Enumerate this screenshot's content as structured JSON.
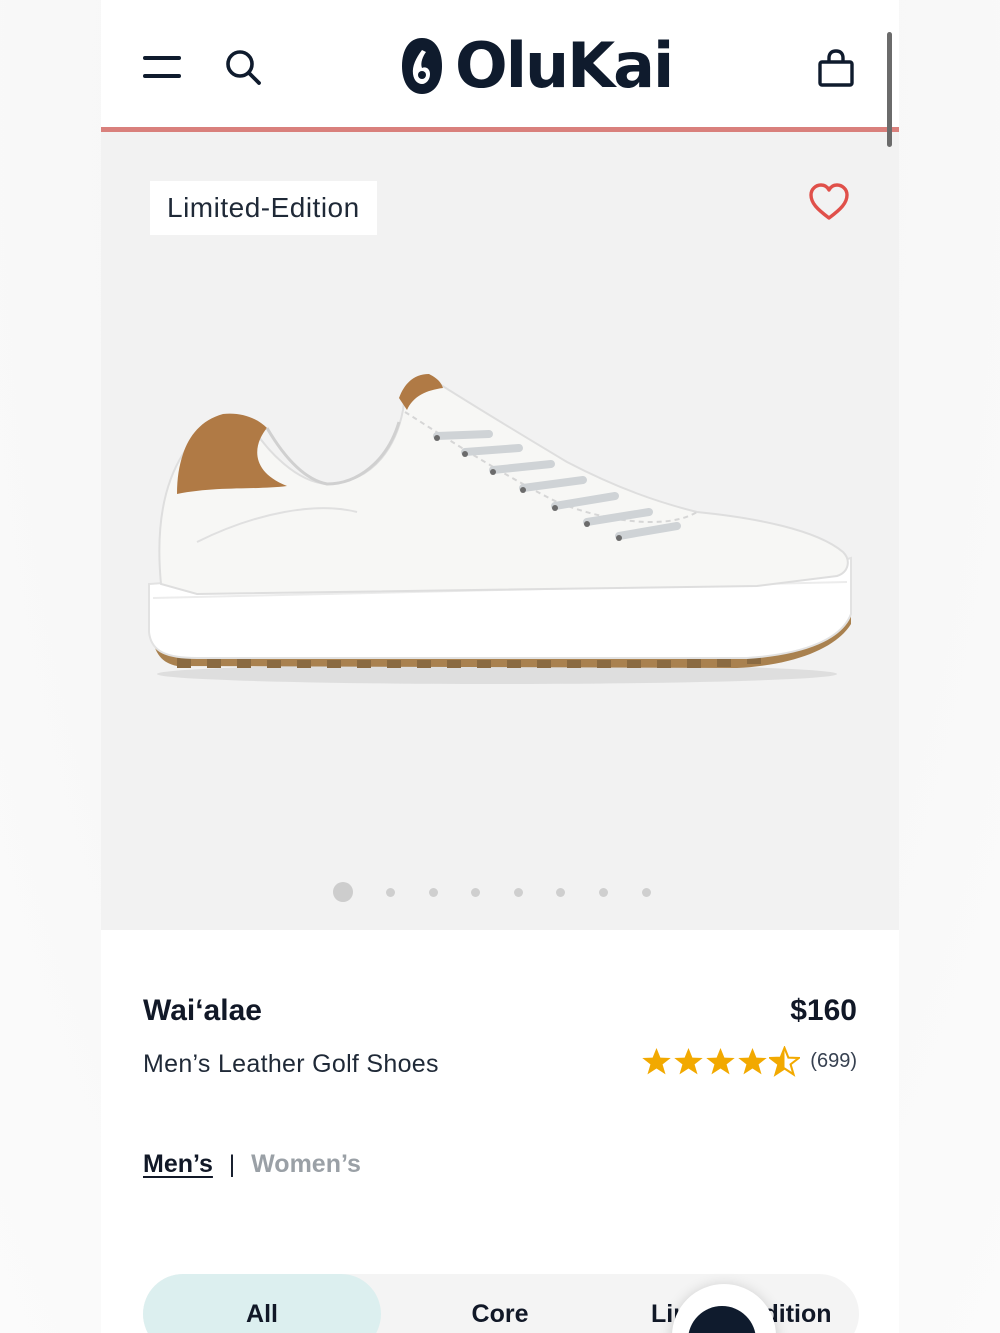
{
  "header": {
    "brand": "OluKai",
    "icons": [
      "menu-icon",
      "search-icon",
      "olukai-logo-mark",
      "shopping-bag-icon"
    ]
  },
  "hero": {
    "badge": "Limited-Edition",
    "favorite_icon": "heart-icon",
    "image": "white leather golf shoe with tan heel",
    "carousel": {
      "total": 8,
      "active_index": 0
    }
  },
  "product": {
    "name": "Wai‘alae",
    "price": "$160",
    "subtitle": "Men’s Leather Golf Shoes",
    "rating": 4.5,
    "review_count": "(699)"
  },
  "gender_toggle": {
    "mens": "Men’s",
    "separator": "|",
    "womens": "Women’s",
    "selected": "Men’s"
  },
  "filters": {
    "all": "All",
    "core": "Core",
    "limited": "Limited Edition",
    "selected": "All"
  },
  "colors": {
    "brand_navy": "#0f1b2d",
    "header_rule": "#d9807c",
    "heart": "#e0504a",
    "star": "#f2a900",
    "selected_pill": "#dcefef"
  }
}
